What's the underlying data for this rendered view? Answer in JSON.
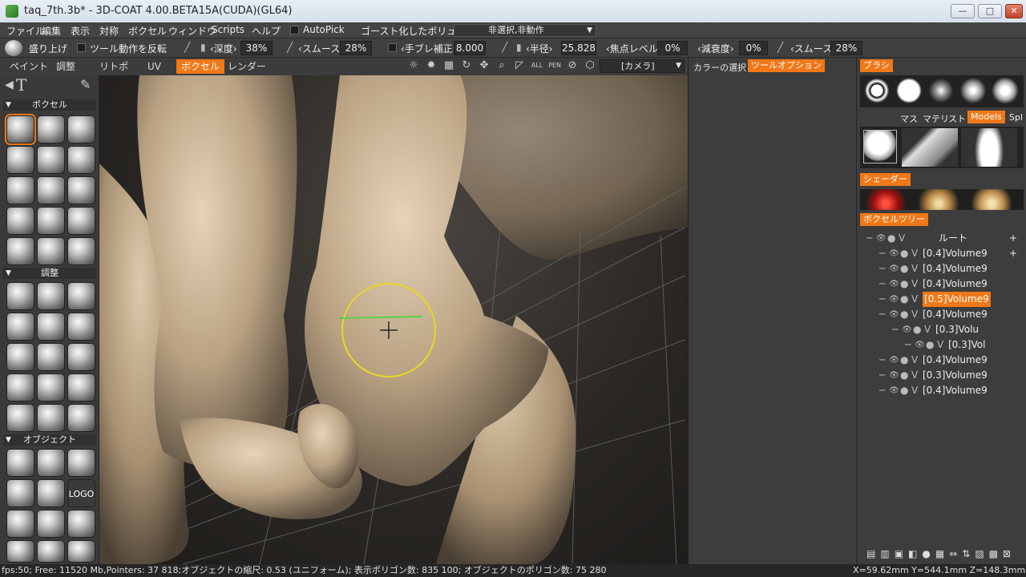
{
  "window": {
    "title": "taq_7th.3b* - 3D-COAT 4.00.BETA15A(CUDA)(GL64)",
    "minimize": "—",
    "maximize": "□",
    "close": "✕"
  },
  "menubar": {
    "items": [
      "ファイル",
      "編集",
      "表示",
      "対称",
      "ボクセル",
      "ウィンドウ",
      "Scripts",
      "ヘルプ"
    ],
    "autopick_label": "AutoPick",
    "ghost_label": "ゴースト化したボリューム:",
    "ghost_value": "非選択,非動作"
  },
  "optbar": {
    "tool_name": "盛り上げ",
    "invert_label": "ツール動作を反転",
    "depth_label": "‹深度›",
    "depth_value": "38%",
    "smooth_label": "‹スムース›",
    "smooth_value": "28%",
    "jitter_label": "‹手ブレ補正›",
    "jitter_value": "8.000",
    "radius_label": "‹半径›",
    "radius_value": "25.828",
    "focal_label": "‹焦点レベル›",
    "focal_value": "0%",
    "falloff_label": "‹減衰度›",
    "falloff_value": "0%",
    "smooth2_label": "‹スムース›",
    "smooth2_value": "28%"
  },
  "tabs": {
    "items": [
      "ペイント",
      "調整",
      "リトポ",
      "UV",
      "ボクセル",
      "レンダー"
    ],
    "active_index": 4,
    "camera_label": "[カメラ]"
  },
  "leftpanel": {
    "voxel_header": "ボクセル",
    "adjust_header": "調整",
    "object_header": "オブジェクト",
    "logo_label": "LOGO"
  },
  "midpanel": {
    "tabs": [
      "カラーの選択",
      "ツールオプション"
    ],
    "active_index": 1
  },
  "rightpanel": {
    "brush_header": "ブラシ",
    "subtabs": [
      "マス",
      "マテリ",
      "ストリ",
      "Models",
      "Spl"
    ],
    "active_subtab": 3,
    "shader_header": "シェーダー",
    "tree_header": "ボクセルツリー",
    "tree": [
      {
        "name": "ルート",
        "indent": 0
      },
      {
        "name": "[0.4]Volume9",
        "indent": 1
      },
      {
        "name": "[0.4]Volume9",
        "indent": 1
      },
      {
        "name": "[0.4]Volume9",
        "indent": 1
      },
      {
        "name": "[0.5]Volume9",
        "indent": 1,
        "selected": true
      },
      {
        "name": "[0.4]Volume9",
        "indent": 1
      },
      {
        "name": "[0.3]Volu",
        "indent": 2
      },
      {
        "name": "[0.3]Vol",
        "indent": 3
      },
      {
        "name": "[0.4]Volume9",
        "indent": 1
      },
      {
        "name": "[0.3]Volume9",
        "indent": 1
      },
      {
        "name": "[0.4]Volume9",
        "indent": 1
      }
    ]
  },
  "statusbar": {
    "left": "fps:50;      Free: 11520 Mb,Pointers: 37  818;オブジェクトの縮尺: 0.53 (ユニフォーム); 表示ポリゴン数: 835  100; オブジェクトのポリゴン数: 75  280",
    "right": "X=59.62mm  Y=544.1mm  Z=148.3mm"
  },
  "colors": {
    "accent": "#f07818",
    "cursor": "#e8d820",
    "stroke_line": "#5ad04a"
  }
}
